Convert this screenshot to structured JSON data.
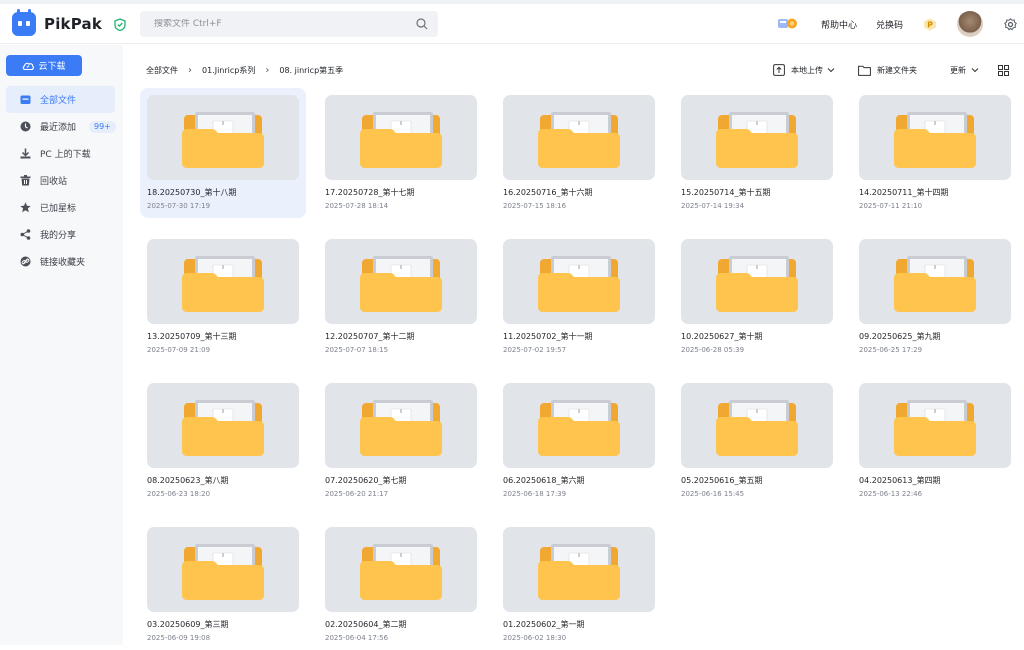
{
  "app": {
    "name": "PikPak"
  },
  "search": {
    "placeholder": "搜索文件 Ctrl+F"
  },
  "header": {
    "help_label": "帮助中心",
    "redeem_label": "兑换码"
  },
  "sidebar": {
    "cloud_download_label": "云下载",
    "items": [
      {
        "label": "全部文件",
        "icon": "folder-icon",
        "active": true
      },
      {
        "label": "最近添加",
        "icon": "clock-icon",
        "badge": "99+"
      },
      {
        "label": "PC 上的下载",
        "icon": "download-icon"
      },
      {
        "label": "回收站",
        "icon": "trash-icon"
      },
      {
        "label": "已加星标",
        "icon": "star-icon"
      },
      {
        "label": "我的分享",
        "icon": "share-icon"
      },
      {
        "label": "链接收藏夹",
        "icon": "link-icon"
      }
    ]
  },
  "breadcrumb": [
    "全部文件",
    "01.Jinricp系列",
    "08. jinricp第五季"
  ],
  "toolbar": {
    "upload_label": "本地上传",
    "new_folder_label": "新建文件夹",
    "sort_label": "更新"
  },
  "files": [
    {
      "name": "18.20250730_第十八期",
      "date": "2025-07-30 17:19",
      "selected": true
    },
    {
      "name": "17.20250728_第十七期",
      "date": "2025-07-28 18:14"
    },
    {
      "name": "16.20250716_第十六期",
      "date": "2025-07-15 18:16"
    },
    {
      "name": "15.20250714_第十五期",
      "date": "2025-07-14 19:34"
    },
    {
      "name": "14.20250711_第十四期",
      "date": "2025-07-11 21:10"
    },
    {
      "name": "13.20250709_第十三期",
      "date": "2025-07-09 21:09"
    },
    {
      "name": "12.20250707_第十二期",
      "date": "2025-07-07 18:15"
    },
    {
      "name": "11.20250702_第十一期",
      "date": "2025-07-02 19:57"
    },
    {
      "name": "10.20250627_第十期",
      "date": "2025-06-28 05:39"
    },
    {
      "name": "09.20250625_第九期",
      "date": "2025-06-25 17:29"
    },
    {
      "name": "08.20250623_第八期",
      "date": "2025-06-23 18:20"
    },
    {
      "name": "07.20250620_第七期",
      "date": "2025-06-20 21:17"
    },
    {
      "name": "06.20250618_第六期",
      "date": "2025-06-18 17:39"
    },
    {
      "name": "05.20250616_第五期",
      "date": "2025-06-16 15:45"
    },
    {
      "name": "04.20250613_第四期",
      "date": "2025-06-13 22:46"
    },
    {
      "name": "03.20250609_第三期",
      "date": "2025-06-09 19:08"
    },
    {
      "name": "02.20250604_第二期",
      "date": "2025-06-04 17:56"
    },
    {
      "name": "01.20250602_第一期",
      "date": "2025-06-02 18:30"
    }
  ],
  "colors": {
    "accent": "#3b7bf6",
    "folder": "#ffc44d",
    "thumb_bg": "#e1e4e9"
  }
}
